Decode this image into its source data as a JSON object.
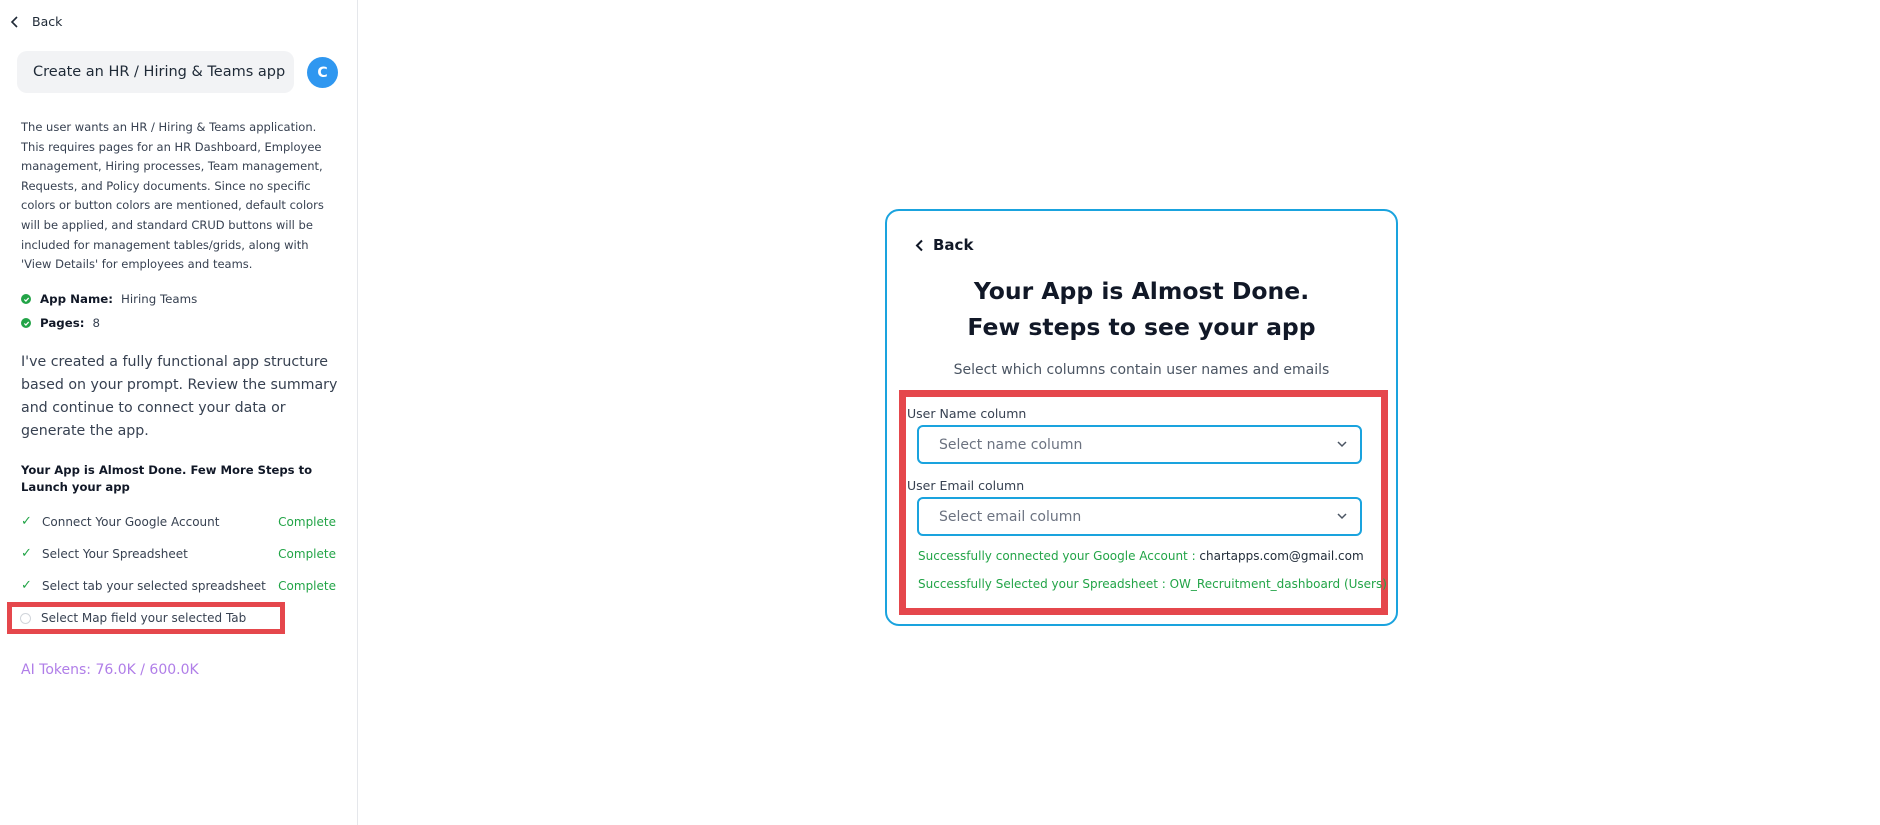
{
  "sidebar": {
    "back_label": "Back",
    "prompt": "Create an HR / Hiring & Teams app",
    "avatar_initial": "C",
    "summary": "The user wants an HR / Hiring & Teams application. This requires pages for an HR Dashboard, Employee management, Hiring processes, Team management, Requests, and Policy documents. Since no specific colors or button colors are mentioned, default colors will be applied, and standard CRUD buttons will be included for management tables/grids, along with 'View Details' for employees and teams.",
    "app_name_label": "App Name:",
    "app_name_value": "Hiring Teams",
    "pages_label": "Pages:",
    "pages_value": "8",
    "created_message": "I've created a fully functional app structure based on your prompt. Review the summary and continue to connect your data or generate the app.",
    "steps_heading": "Your App is Almost Done. Few More Steps to Launch your app",
    "steps": [
      {
        "label": "Connect Your Google Account",
        "status": "Complete"
      },
      {
        "label": "Select Your Spreadsheet",
        "status": "Complete"
      },
      {
        "label": "Select tab your selected spreadsheet",
        "status": "Complete"
      },
      {
        "label": "Select Map field your selected Tab",
        "status": ""
      }
    ],
    "tokens": "AI Tokens: 76.0K / 600.0K"
  },
  "card": {
    "back_label": "Back",
    "title_line1": "Your App is Almost Done.",
    "title_line2": "Few steps to see your app",
    "subtitle": "Select which columns contain user names and emails",
    "user_name_label": "User Name column",
    "user_name_placeholder": "Select name column",
    "user_email_label": "User Email column",
    "user_email_placeholder": "Select email column",
    "success_google_prefix": "Successfully connected your Google Account : ",
    "success_google_value": "chartapps.com@gmail.com",
    "success_sheet_prefix": "Successfully Selected your Spreadsheet : ",
    "success_sheet_value": "OW_Recruitment_dashboard (Users)"
  },
  "colors": {
    "accent_blue": "#1aa3de",
    "highlight_red": "#e5474c",
    "success_green": "#22a447",
    "token_purple": "#b07ee8",
    "avatar_blue": "#2f97f0"
  }
}
